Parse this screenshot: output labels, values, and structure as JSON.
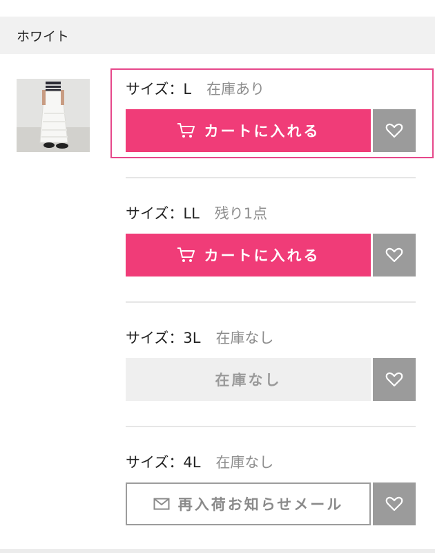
{
  "header": {
    "color_name": "ホワイト"
  },
  "product_image": {
    "description": "white-skirt"
  },
  "sizes": [
    {
      "size_label": "サイズ：L",
      "stock": "在庫あり",
      "button_label": "カートに入れる",
      "button_type": "cart"
    },
    {
      "size_label": "サイズ：LL",
      "stock": "残り1点",
      "button_label": "カートに入れる",
      "button_type": "cart"
    },
    {
      "size_label": "サイズ：3L",
      "stock": "在庫なし",
      "button_label": "在庫なし",
      "button_type": "out"
    },
    {
      "size_label": "サイズ：4L",
      "stock": "在庫なし",
      "button_label": "再入荷お知らせメール",
      "button_type": "notify"
    }
  ],
  "colors": {
    "cart_pink": "#f03c78",
    "highlight": "#e6478a",
    "fav_gray": "#9b9b9b",
    "out_bg": "#efefef"
  },
  "icons": {
    "cart": "cart-icon",
    "favorite": "heart-icon",
    "mail": "mail-icon"
  }
}
